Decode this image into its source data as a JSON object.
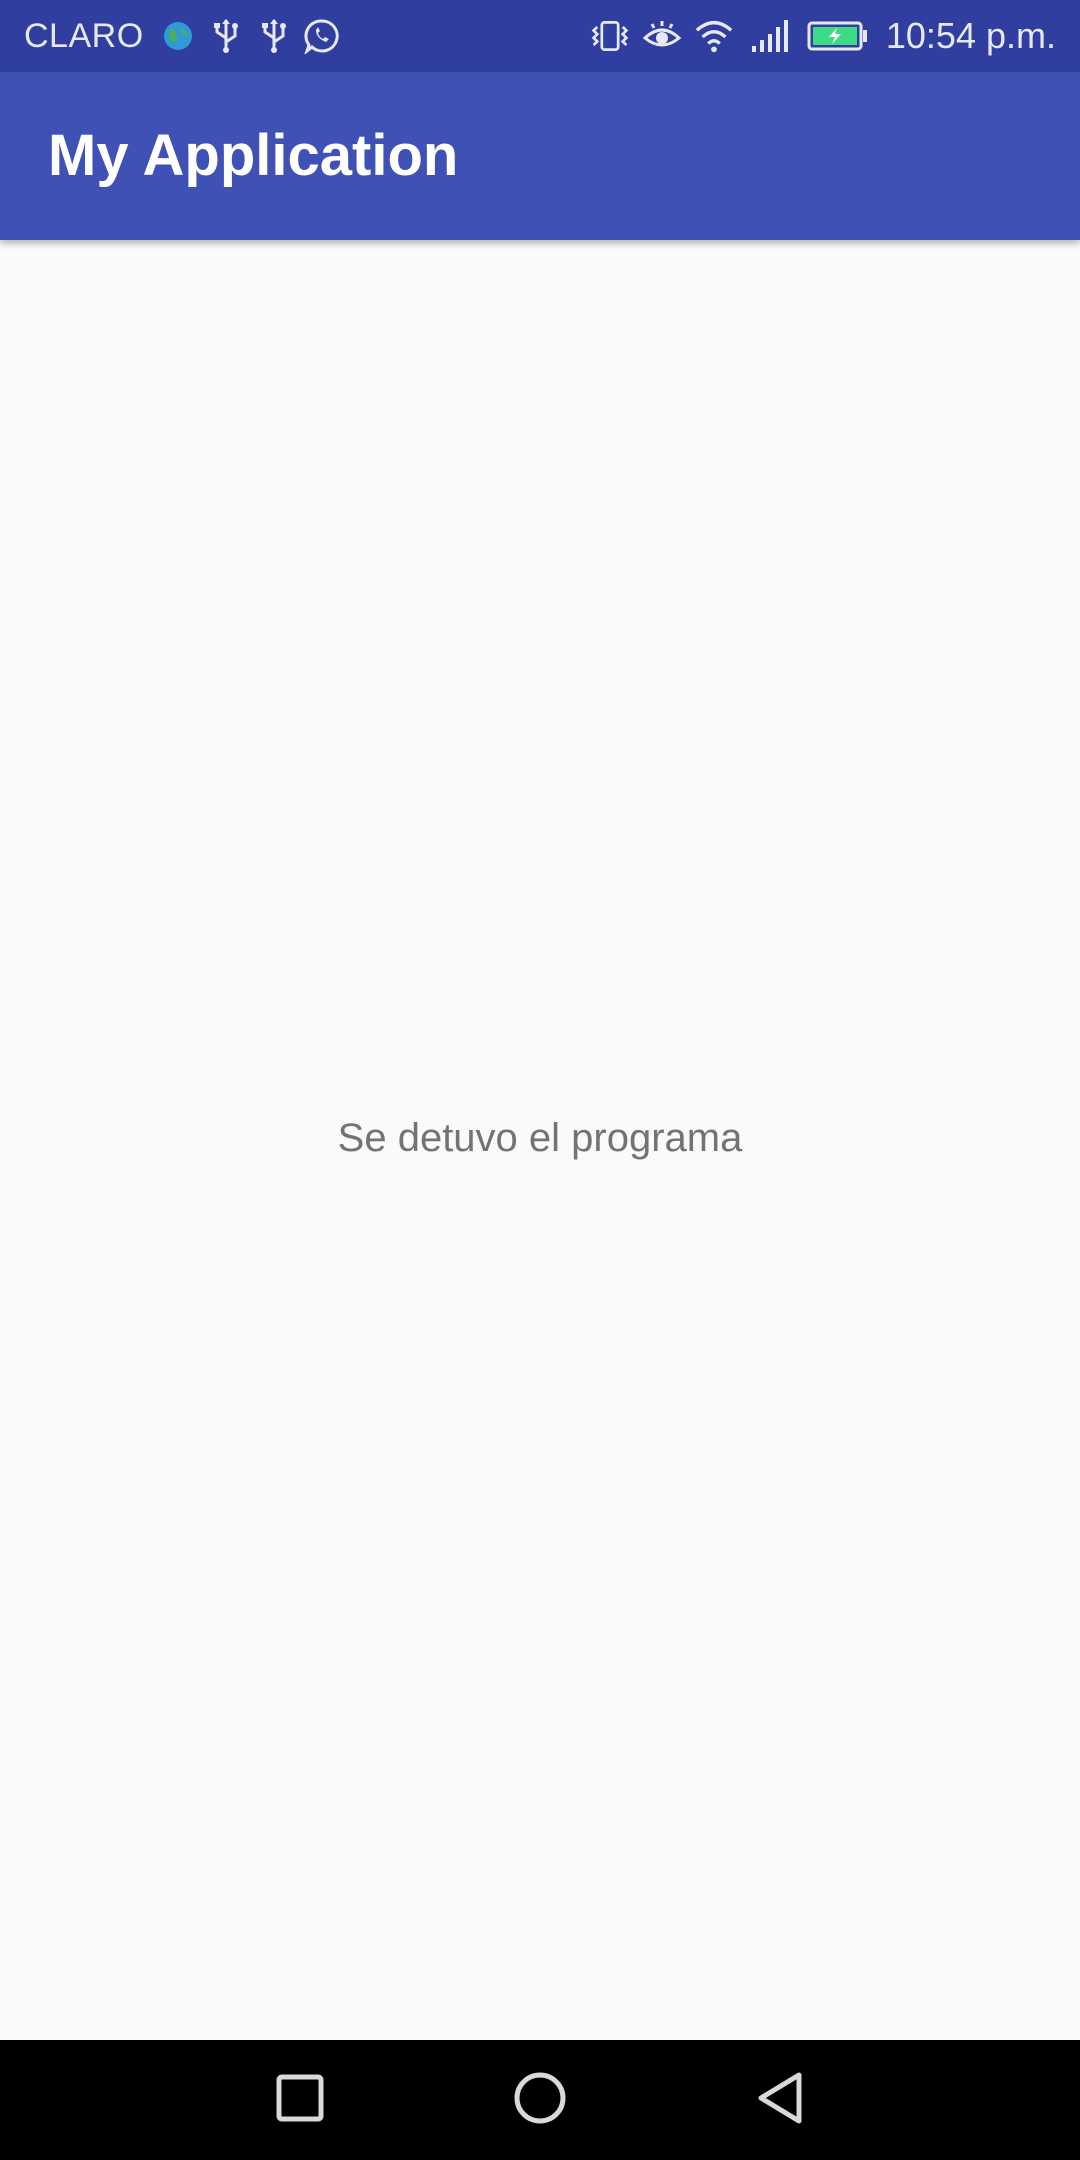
{
  "status_bar": {
    "carrier": "CLARO",
    "time": "10:54 p.m.",
    "left_icons": [
      "globe-icon",
      "usb-icon",
      "usb-icon",
      "whatsapp-icon"
    ],
    "right_icons": [
      "vibrate-icon",
      "eye-comfort-icon",
      "wifi-icon",
      "signal-icon",
      "battery-charging-icon"
    ],
    "background_color": "#303f9f"
  },
  "app_bar": {
    "title": "My Application",
    "background_color": "#3f51b5"
  },
  "content": {
    "message": "Se detuvo el programa"
  },
  "nav_bar": {
    "buttons": [
      "recents-icon",
      "home-icon",
      "back-icon"
    ]
  }
}
